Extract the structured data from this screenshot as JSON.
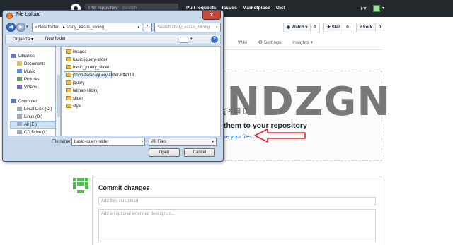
{
  "header": {
    "search_scope": "This repository",
    "search_placeholder": "Search",
    "nav": [
      "Pull requests",
      "Issues",
      "Marketplace",
      "Gist"
    ],
    "plus": "+▾",
    "caret": "▾"
  },
  "repo": {
    "actions": [
      {
        "label": "◉ Watch ▾",
        "count": "0"
      },
      {
        "label": "★ Star",
        "count": "0"
      },
      {
        "label": "⑂ Fork",
        "count": "0"
      }
    ],
    "tabs": [
      "Wiki",
      "⚙ Settings",
      "Insights ▾"
    ]
  },
  "upload": {
    "drag_text": "them to your repository",
    "choose_text": "se your files",
    "icons": "<> ▤ ▯"
  },
  "commit": {
    "title": "Commit changes",
    "summary_placeholder": "Add files via upload",
    "description_placeholder": "Add an optional extended description..."
  },
  "watermark": "KUYANDZGN",
  "dialog": {
    "title": "File Upload",
    "close": "x",
    "back": "◀",
    "forward": "▶",
    "drop": "▾",
    "address": "« New folder... ▸ study_kasus_slicing",
    "address_caret": "▾",
    "refresh": "↻",
    "search_placeholder": "Search study_kasus_slicing",
    "search_icon": "⌕",
    "organize": "Organize ▾",
    "new_folder": "New folder",
    "view_caret": "▾",
    "help": "?",
    "nav_items": [
      {
        "label": "Libraries",
        "color": "#6a7fb0"
      },
      {
        "label": "Documents",
        "color": "#d8c070"
      },
      {
        "label": "Music",
        "color": "#5a8ad0"
      },
      {
        "label": "Pictures",
        "color": "#6aa060"
      },
      {
        "label": "Videos",
        "color": "#7a6ab0"
      },
      {
        "label": "Computer",
        "color": "#5a7ab0"
      },
      {
        "label": "Local Disk (C:)",
        "color": "#9aa8b8"
      },
      {
        "label": "Linux (D:)",
        "color": "#9aa8b8"
      },
      {
        "label": "All (E:)",
        "color": "#9aa8b8"
      },
      {
        "label": "CD Drive (I:)",
        "color": "#9aa8b8"
      }
    ],
    "files": [
      "images",
      "basic-jquery-slider",
      "basic_jquery_slider",
      "jcobb-basic-jquery-slider-8ffe118",
      "jquery",
      "latihan-slicing",
      "slider",
      "style"
    ],
    "file_name_label": "File name:",
    "file_name_value": "basic-jquery-slider",
    "file_name_caret": "▾",
    "file_type": "All Files",
    "file_type_caret": "▾",
    "open": "Open",
    "cancel": "Cancel"
  },
  "colors": {
    "header_bg": "#24292e",
    "link": "#0366d6",
    "arrow": "#e8262a",
    "dialog_bg": "#c9d9ec"
  }
}
